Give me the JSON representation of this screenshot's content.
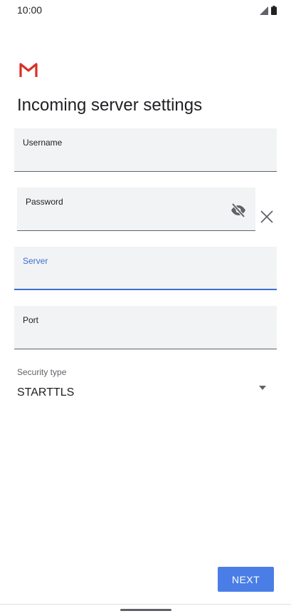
{
  "status_bar": {
    "time": "10:00",
    "icons": [
      "signal-icon",
      "battery-icon"
    ]
  },
  "app": {
    "logo": "gmail-logo",
    "brand_color": "#d93025"
  },
  "page_title": "Incoming server settings",
  "fields": {
    "username": {
      "label": "Username",
      "value": ""
    },
    "password": {
      "label": "Password",
      "value": "",
      "visibility_icon": "visibility-off-icon"
    },
    "server": {
      "label": "Server",
      "value": "",
      "focused": true
    },
    "port": {
      "label": "Port",
      "value": ""
    }
  },
  "security": {
    "label": "Security type",
    "selected": "STARTTLS"
  },
  "next_button": {
    "label": "NEXT"
  },
  "colors": {
    "accent": "#3c6fd1",
    "button": "#4a7ee6",
    "field_bg": "#f1f3f4"
  }
}
